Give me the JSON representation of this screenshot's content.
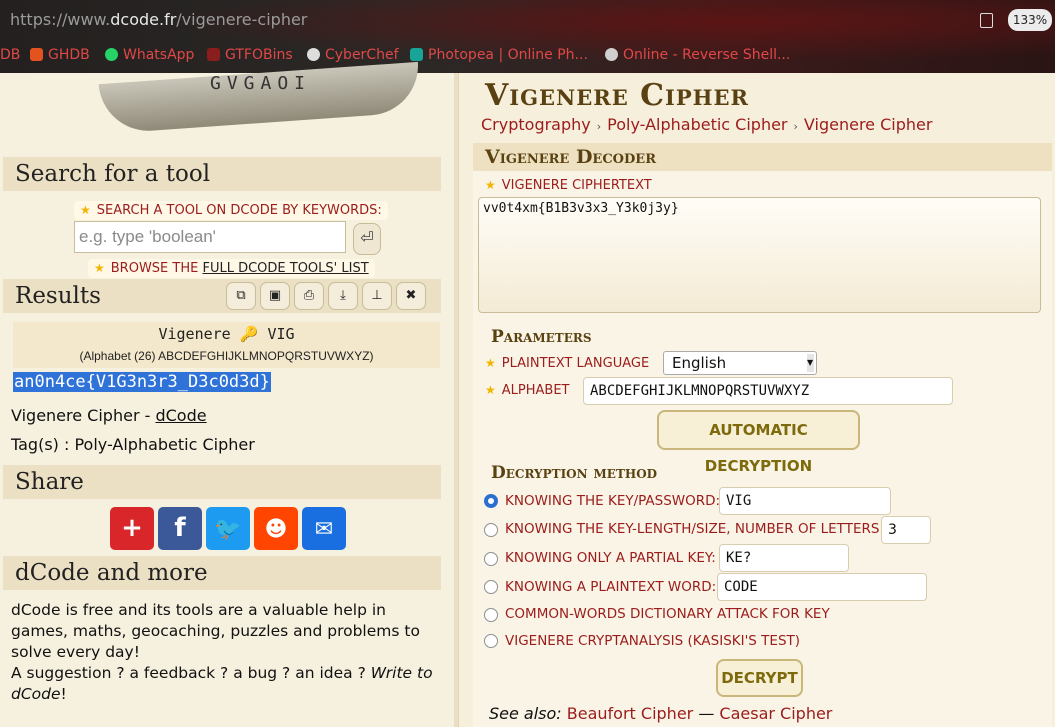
{
  "browser": {
    "url_prefix": "https://www.",
    "url_domain": "dcode.fr",
    "url_path": "/vigenere-cipher",
    "zoom": "133%",
    "bookmarks": [
      {
        "label": "DB",
        "icon": ""
      },
      {
        "label": "GHDB",
        "icon": "ghdb-icon"
      },
      {
        "label": "WhatsApp",
        "icon": "whatsapp-icon"
      },
      {
        "label": "GTFOBins",
        "icon": "gtfobins-icon"
      },
      {
        "label": "CyberChef",
        "icon": "cyberchef-icon"
      },
      {
        "label": "Photopea | Online Ph...",
        "icon": "photopea-icon"
      },
      {
        "label": "Online - Reverse Shell...",
        "icon": "skull-icon"
      }
    ]
  },
  "sidebar": {
    "logo_letters": "GVGAOI",
    "search_head": "Search for a tool",
    "search_label": "SEARCH A TOOL ON DCODE BY KEYWORDS:",
    "search_placeholder": "e.g. type 'boolean'",
    "enter_glyph": "⏎",
    "browse_prefix": "BROWSE THE ",
    "browse_link": "FULL DCODE TOOLS' LIST",
    "results_head": "Results",
    "result_title": "Vigenere 🔑 VIG",
    "result_sub": "(Alphabet (26) ABCDEFGHIJKLMNOPQRSTUVWXYZ)",
    "result_value": "an0n4ce{V1G3n3r3_D3c0d3d}",
    "tool_name": "Vigenere Cipher - ",
    "tool_link": "dCode",
    "tags": "Tag(s) : Poly-Alphabetic Cipher",
    "share_head": "Share",
    "more_head": "dCode and more",
    "about_text": "dCode is free and its tools are a valuable help in games, maths, geocaching, puzzles and problems to solve every day!",
    "suggestion_prefix": "A suggestion ? a feedback ? a bug ? an idea ? ",
    "suggestion_link": "Write to dCode",
    "suggestion_suffix": "!"
  },
  "main": {
    "title": "Vigenere Cipher",
    "breadcrumbs": [
      "Cryptography",
      "Poly-Alphabetic Cipher",
      "Vigenere Cipher"
    ],
    "decoder_head": "Vigenere Decoder",
    "ciphertext_label": "VIGENERE CIPHERTEXT",
    "ciphertext_value": "vv0t4xm{B1B3v3x3_Y3k0j3y}",
    "parameters_head": "Parameters",
    "language_label": "PLAINTEXT LANGUAGE",
    "language_value": "English",
    "alphabet_label": "ALPHABET",
    "alphabet_value": "ABCDEFGHIJKLMNOPQRSTUVWXYZ",
    "auto_button": "AUTOMATIC DECRYPTION",
    "method_head": "Decryption method",
    "options": [
      {
        "label": "KNOWING THE KEY/PASSWORD:",
        "value": "VIG",
        "selected": true
      },
      {
        "label": "KNOWING THE KEY-LENGTH/SIZE, NUMBER OF LETTERS:",
        "value": "3",
        "selected": false
      },
      {
        "label": "KNOWING ONLY A PARTIAL KEY:",
        "value": "KE?",
        "selected": false
      },
      {
        "label": "KNOWING A PLAINTEXT WORD:",
        "value": "CODE",
        "selected": false
      },
      {
        "label": "COMMON-WORDS DICTIONARY ATTACK FOR KEY",
        "selected": false
      },
      {
        "label": "VIGENERE CRYPTANALYSIS (KASISKI'S TEST)",
        "selected": false
      }
    ],
    "decrypt_button": "DECRYPT",
    "see_also_prefix": "See also: ",
    "see_also_links": [
      "Beaufort Cipher",
      "Caesar Cipher"
    ],
    "see_also_sep": " — "
  },
  "colors": {
    "accent_red": "#9b1c1c",
    "heading_brown": "#5a4112",
    "selection_blue": "#2f73d9",
    "star_yellow": "#f1b500"
  }
}
